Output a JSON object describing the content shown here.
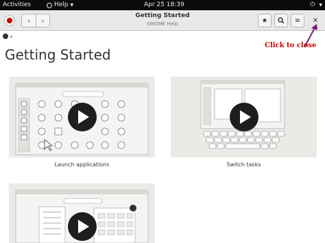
{
  "topbar": {
    "activities": "Activities",
    "help_menu": "Help",
    "clock": "Apr 25  18:39"
  },
  "headerbar": {
    "title": "Getting Started",
    "subtitle": "GNOME Help"
  },
  "breadcrumb": {
    "separator": "»"
  },
  "annotation": {
    "text": "Click to close",
    "color": "#cc0000"
  },
  "page": {
    "title": "Getting Started"
  },
  "cards": [
    {
      "caption": "Launch applications"
    },
    {
      "caption": "Switch tasks"
    },
    {
      "caption": ""
    }
  ],
  "icons": {
    "nav_back": "chevron-left-icon",
    "nav_forward": "chevron-right-icon",
    "bookmark": "star-icon",
    "search": "search-icon",
    "menu": "hamburger-icon",
    "close": "close-icon"
  }
}
